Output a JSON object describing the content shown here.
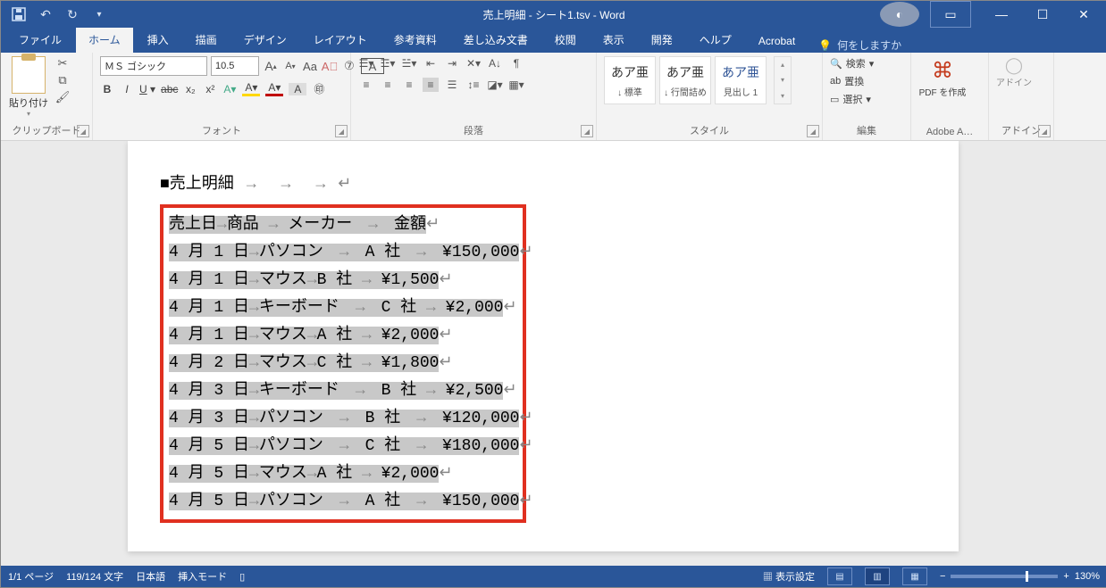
{
  "titlebar": {
    "title": "売上明細 - シート1.tsv - Word"
  },
  "tabs": [
    "ファイル",
    "ホーム",
    "挿入",
    "描画",
    "デザイン",
    "レイアウト",
    "参考資料",
    "差し込み文書",
    "校閲",
    "表示",
    "開発",
    "ヘルプ",
    "Acrobat"
  ],
  "active_tab": 1,
  "tellme": "何をしますか",
  "ribbon": {
    "clipboard": {
      "label": "クリップボード",
      "paste": "貼り付け"
    },
    "font": {
      "label": "フォント",
      "name": "ＭＳ ゴシック",
      "size": "10.5"
    },
    "paragraph": {
      "label": "段落"
    },
    "styles": {
      "label": "スタイル",
      "items": [
        {
          "sample": "あア亜",
          "name": "↓ 標準"
        },
        {
          "sample": "あア亜",
          "name": "↓ 行間詰め"
        },
        {
          "sample": "あア亜",
          "name": "見出し 1",
          "blue": true
        }
      ]
    },
    "editing": {
      "label": "編集",
      "find": "検索",
      "replace": "置換",
      "select": "選択"
    },
    "adobe": {
      "label": "Adobe A…",
      "pdf": "PDF を作成"
    },
    "addin": {
      "label": "アドイン",
      "text": "アドイン"
    }
  },
  "document": {
    "title_line": "■売上明細",
    "header": [
      "売上日",
      "商品",
      "メーカー",
      "金額"
    ],
    "rows": [
      {
        "d": "4 月 1 日",
        "p": "パソコン",
        "m": "A 社",
        "a": "¥150,000",
        "pad_p": true,
        "pad_m": true
      },
      {
        "d": "4 月 1 日",
        "p": "マウス",
        "m": "B 社",
        "a": "¥1,500"
      },
      {
        "d": "4 月 1 日",
        "p": "キーボード",
        "m": "C 社",
        "a": "¥2,000",
        "pad_p": true
      },
      {
        "d": "4 月 1 日",
        "p": "マウス",
        "m": "A 社",
        "a": "¥2,000"
      },
      {
        "d": "4 月 2 日",
        "p": "マウス",
        "m": "C 社",
        "a": "¥1,800"
      },
      {
        "d": "4 月 3 日",
        "p": "キーボード",
        "m": "B 社",
        "a": "¥2,500",
        "pad_p": true
      },
      {
        "d": "4 月 3 日",
        "p": "パソコン",
        "m": "B 社",
        "a": "¥120,000",
        "pad_p": true,
        "pad_m": true
      },
      {
        "d": "4 月 5 日",
        "p": "パソコン",
        "m": "C 社",
        "a": "¥180,000",
        "pad_p": true,
        "pad_m": true
      },
      {
        "d": "4 月 5 日",
        "p": "マウス",
        "m": "A 社",
        "a": "¥2,000"
      },
      {
        "d": "4 月 5 日",
        "p": "パソコン",
        "m": "A 社",
        "a": "¥150,000",
        "pad_p": true,
        "pad_m": true
      }
    ]
  },
  "statusbar": {
    "page": "1/1 ページ",
    "words": "119/124 文字",
    "lang": "日本語",
    "mode": "挿入モード",
    "display": "表示設定",
    "zoom": "130%"
  }
}
